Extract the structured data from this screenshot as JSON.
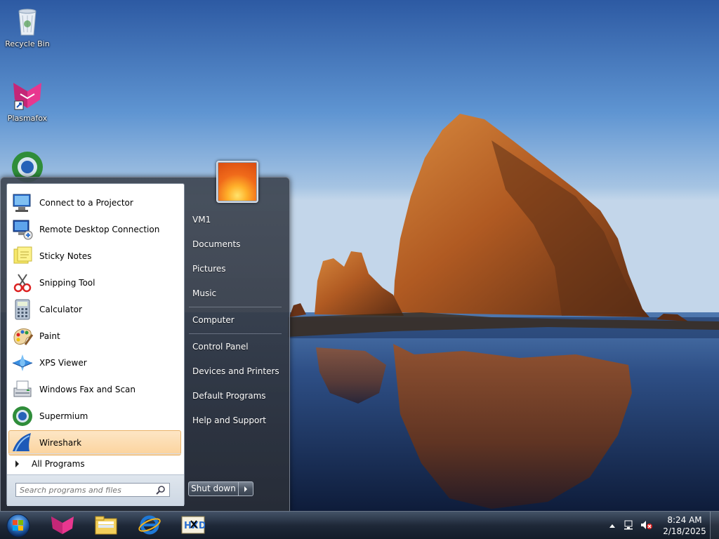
{
  "desktop": {
    "icons": [
      {
        "name": "recycle-bin",
        "label": "Recycle Bin"
      },
      {
        "name": "plasmafox",
        "label": "Plasmafox"
      },
      {
        "name": "supermium",
        "label": ""
      }
    ]
  },
  "start_menu": {
    "programs": [
      {
        "label": "Connect to a Projector",
        "icon": "projector-icon"
      },
      {
        "label": "Remote Desktop Connection",
        "icon": "remote-desktop-icon"
      },
      {
        "label": "Sticky Notes",
        "icon": "sticky-notes-icon"
      },
      {
        "label": "Snipping Tool",
        "icon": "snipping-tool-icon"
      },
      {
        "label": "Calculator",
        "icon": "calculator-icon"
      },
      {
        "label": "Paint",
        "icon": "paint-icon"
      },
      {
        "label": "XPS Viewer",
        "icon": "xps-viewer-icon"
      },
      {
        "label": "Windows Fax and Scan",
        "icon": "fax-scan-icon"
      },
      {
        "label": "Supermium",
        "icon": "supermium-icon"
      },
      {
        "label": "Wireshark",
        "icon": "wireshark-icon",
        "selected": true
      }
    ],
    "all_programs_label": "All Programs",
    "search_placeholder": "Search programs and files",
    "places": [
      {
        "label": "VM1"
      },
      {
        "label": "Documents"
      },
      {
        "label": "Pictures"
      },
      {
        "label": "Music"
      },
      {
        "label": "Computer"
      },
      {
        "label": "Control Panel"
      },
      {
        "label": "Devices and Printers"
      },
      {
        "label": "Default Programs"
      },
      {
        "label": "Help and Support"
      }
    ],
    "shutdown_label": "Shut down"
  },
  "taskbar": {
    "pinned": [
      "plasmafox-icon",
      "file-explorer-icon",
      "internet-explorer-icon",
      "hxd-icon"
    ],
    "tray": {
      "time": "8:24 AM",
      "date": "2/18/2025"
    }
  },
  "colors": {
    "selected_bg": "#fbd39d",
    "menu_bg": "#3e4652",
    "taskbar_bg": "#1e2837"
  }
}
